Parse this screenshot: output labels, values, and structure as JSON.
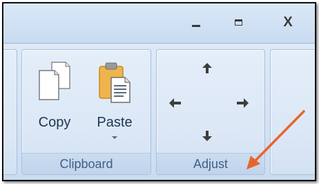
{
  "window_controls": {
    "minimize_icon": "minimize-icon",
    "maximize_icon": "maximize-icon",
    "close_label": "X"
  },
  "ribbon": {
    "groups": [
      {
        "label": "Clipboard",
        "buttons": [
          {
            "label": "Copy",
            "icon": "copy-icon"
          },
          {
            "label": "Paste",
            "icon": "paste-icon",
            "has_dropdown": true
          }
        ]
      },
      {
        "label": "Adjust",
        "buttons": [
          {
            "icon": "arrow-up-icon"
          },
          {
            "icon": "arrow-left-icon"
          },
          {
            "icon": "arrow-right-icon"
          },
          {
            "icon": "arrow-down-icon"
          }
        ]
      }
    ]
  },
  "colors": {
    "annotation_arrow": "#e8652a",
    "group_label_text": "#3f5f86",
    "ribbon_background": "#d5e3f4"
  }
}
